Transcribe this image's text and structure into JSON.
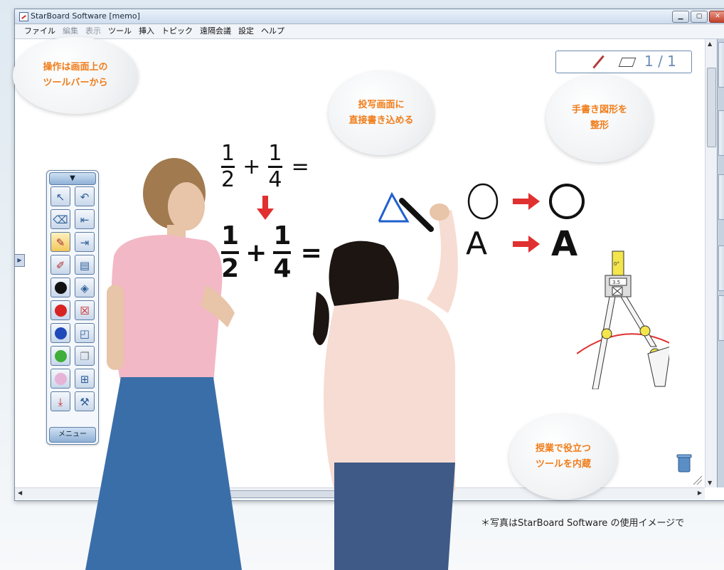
{
  "window": {
    "title": "StarBoard Software [memo]",
    "buttons": {
      "minimize": "▁",
      "maximize": "▢",
      "close": "✕"
    }
  },
  "menu": [
    "ファイル",
    "編集",
    "表示",
    "ツール",
    "挿入",
    "トピック",
    "遠隔会議",
    "設定",
    "ヘルプ"
  ],
  "page_indicator": {
    "page": "1 / 1"
  },
  "toolbar": {
    "bottom_label": "メニュー",
    "colors": {
      "black": "#111111",
      "red": "#d82323",
      "blue": "#1f49b8",
      "green": "#3fae3a",
      "pink": "#e6b3d6"
    }
  },
  "board": {
    "eq1": {
      "a_num": "1",
      "a_den": "2",
      "op": "+",
      "b_num": "1",
      "b_den": "4",
      "eq": "="
    },
    "eq2": {
      "a_num": "1",
      "a_den": "2",
      "op": "+",
      "b_num": "1",
      "b_den": "4",
      "eq": "="
    },
    "shape_row1_left": "O",
    "shape_row1_right": "O",
    "shape_row2_left": "A",
    "shape_row2_right": "A",
    "compass_label": "3.5",
    "compass_top": "0°"
  },
  "bubbles": {
    "toolbar_tip": "操作は画面上の\nツールバーから",
    "write_tip": "投写画面に\n直接書き込める",
    "shape_tip": "手書き図形を\n整形",
    "tools_tip": "授業で役立つ\nツールを内蔵"
  },
  "caption": "＊写真はStarBoard Software の使用イメージで",
  "accent_color": "#f07d1a",
  "arrow_color": "#e03030"
}
